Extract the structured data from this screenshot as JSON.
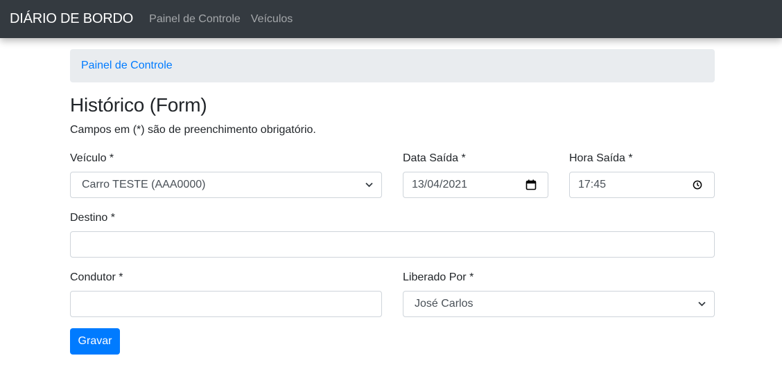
{
  "navbar": {
    "brand": "DIÁRIO DE BORDO",
    "links": [
      "Painel de Controle",
      "Veículos"
    ]
  },
  "breadcrumb": {
    "item": "Painel de Controle"
  },
  "page": {
    "title": "Histórico (Form)",
    "hint": "Campos em (*) são de preenchimento obrigatório."
  },
  "form": {
    "veiculo": {
      "label": "Veículo *",
      "value": "Carro TESTE (AAA0000)"
    },
    "data_saida": {
      "label": "Data Saída *",
      "value": "13/04/2021"
    },
    "hora_saida": {
      "label": "Hora Saída *",
      "value": "17:45"
    },
    "destino": {
      "label": "Destino *",
      "value": ""
    },
    "condutor": {
      "label": "Condutor *",
      "value": ""
    },
    "liberado_por": {
      "label": "Liberado Por *",
      "value": "José Carlos"
    },
    "submit_label": "Gravar"
  },
  "colors": {
    "navbar_bg": "#343a40",
    "primary": "#007bff",
    "breadcrumb_bg": "#e9ecef"
  },
  "icons": {
    "select_chevron": "chevron-down-icon",
    "date": "calendar-icon",
    "time": "clock-icon"
  }
}
